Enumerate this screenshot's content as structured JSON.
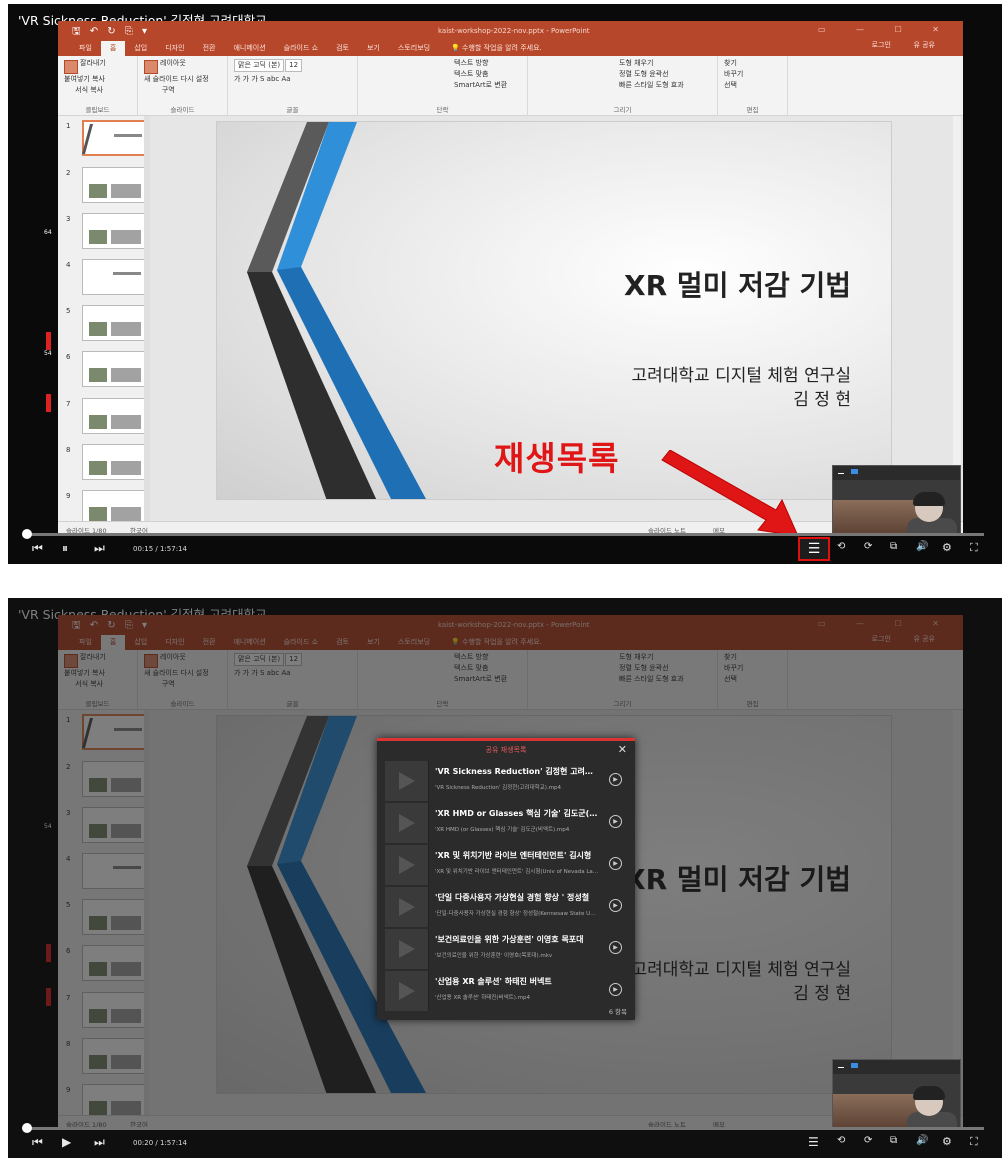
{
  "video": {
    "title": "'VR Sickness Reduction' 김정현 고려대학교"
  },
  "ppt": {
    "quick_access": "🖫 ↶ ↻ ⎘ ▾",
    "filename": "kaist-workshop-2022-nov.pptx - PowerPoint",
    "window_buttons": "▭ — ☐ ✕",
    "tabs": [
      "파일",
      "홈",
      "삽입",
      "디자인",
      "전환",
      "애니메이션",
      "슬라이드 쇼",
      "검토",
      "보기",
      "스토리보딩"
    ],
    "tell_me": "💡 수행할 작업을 알려 주세요.",
    "login": "로그인",
    "share": "유 공유",
    "ribbon_groups": [
      {
        "name": "클립보드",
        "items": [
          "붙여넣기",
          "잘라내기",
          "복사",
          "서식 복사"
        ]
      },
      {
        "name": "슬라이드",
        "items": [
          "새 슬라이드",
          "레이아웃",
          "다시 설정",
          "구역"
        ]
      },
      {
        "name": "글꼴",
        "items": [
          "맑은 고딕 (본)",
          "12",
          "가 가 가 S abc",
          "Aa"
        ]
      },
      {
        "name": "단락",
        "items": [
          "텍스트 방향",
          "텍스트 맞춤",
          "SmartArt로 변환"
        ]
      },
      {
        "name": "그리기",
        "items": [
          "정렬",
          "빠른 스타일",
          "도형 채우기",
          "도형 윤곽선",
          "도형 효과"
        ]
      },
      {
        "name": "편집",
        "items": [
          "찾기",
          "바꾸기",
          "선택"
        ]
      }
    ],
    "slide_numbers": [
      "1",
      "2",
      "3",
      "4",
      "5",
      "6",
      "7",
      "8",
      "9"
    ],
    "slide_title": "XR 멀미 저감 기법",
    "slide_sub1": "고려대학교 디지털 체험 연구실",
    "slide_sub2": "김 정 현",
    "status_slide": "슬라이드 1/80",
    "status_lang": "한국어",
    "status_notes": "슬라이드 노트",
    "status_memo": "메모"
  },
  "player1": {
    "time": "00:15 / 1:57:14",
    "progress": 0.0021
  },
  "player2": {
    "time": "00:20 / 1:57:14",
    "progress": 0.0028
  },
  "annotation": {
    "label": "재생목록",
    "color": "#e01515"
  },
  "playlist": {
    "title": "공유 재생목록",
    "count": "6 항목",
    "items": [
      {
        "title": "'VR Sickness Reduction' 김정현 고려대학교",
        "file": "'VR Sickness Reduction' 김정현(고려대학교).mp4"
      },
      {
        "title": "'XR HMD or Glasses 핵심 기술' 김도군(비엑트)",
        "file": "'XR HMD (or Glasses) 핵심 기술' 김도군(비엑트).mp4"
      },
      {
        "title": "'XR 및 위치기반 라이브 엔터테인먼트' 김시형",
        "file": "'XR 및 위치기반 라이브 엔터테인먼트' 김시형(Univ of Nevada Las Vegas).mp4"
      },
      {
        "title": "'단일 다중사용자 가상현실 경험 향상 ' 정성철",
        "file": "'단일-다중사용자 가상현실 경험 향상' 정성철(Kennesaw State University).mp4"
      },
      {
        "title": "'보건의료인을 위한 가상훈련' 이영호 목포대",
        "file": "'보건의료인을 위한 가상훈련' 이영호(목포대).mkv"
      },
      {
        "title": "'산업용 XR 솔루션' 하태진 버넥트",
        "file": "'산업용 XR 솔루션' 하태진(버넥트).mp4"
      }
    ]
  },
  "side_marks": [
    "64",
    "54",
    "54",
    "64"
  ],
  "icons": {
    "prev": "skip-back-icon",
    "pause": "pause-icon",
    "play": "play-icon",
    "next": "skip-forward-icon",
    "playlist": "list-icon",
    "rewind10": "rewind-10-icon",
    "forward10": "forward-10-icon",
    "pip": "picture-in-picture-icon",
    "volume": "volume-icon",
    "settings": "gear-icon",
    "fullscreen": "fullscreen-icon"
  }
}
